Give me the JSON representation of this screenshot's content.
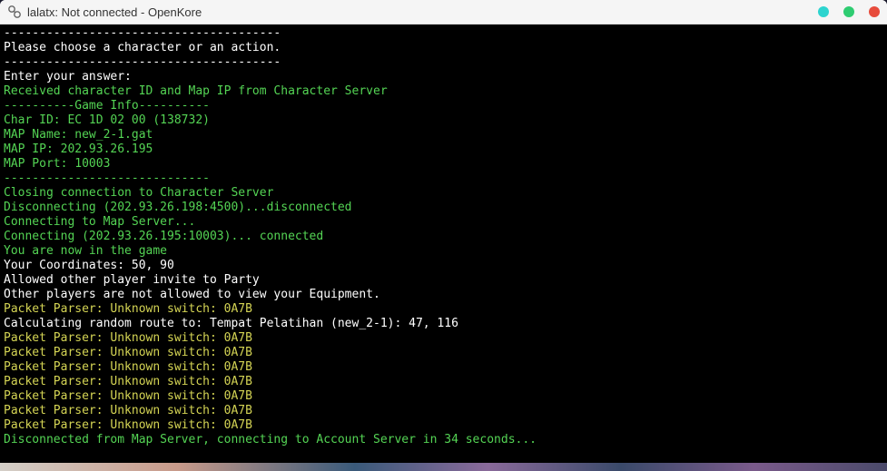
{
  "window": {
    "title": "lalatx: Not connected - OpenKore"
  },
  "lines": [
    {
      "cls": "w",
      "text": "---------------------------------------"
    },
    {
      "cls": "w",
      "text": "Please choose a character or an action."
    },
    {
      "cls": "w",
      "text": "---------------------------------------"
    },
    {
      "cls": "w",
      "text": "Enter your answer: "
    },
    {
      "cls": "g",
      "text": "Received character ID and Map IP from Character Server"
    },
    {
      "cls": "g",
      "text": "----------Game Info----------"
    },
    {
      "cls": "g",
      "text": "Char ID: EC 1D 02 00 (138732)"
    },
    {
      "cls": "g",
      "text": "MAP Name: new_2-1.gat"
    },
    {
      "cls": "g",
      "text": "MAP IP: 202.93.26.195"
    },
    {
      "cls": "g",
      "text": "MAP Port: 10003"
    },
    {
      "cls": "g",
      "text": "-----------------------------"
    },
    {
      "cls": "g",
      "text": "Closing connection to Character Server"
    },
    {
      "cls": "g",
      "text": "Disconnecting (202.93.26.198:4500)...disconnected"
    },
    {
      "cls": "g",
      "text": "Connecting to Map Server..."
    },
    {
      "cls": "g",
      "text": "Connecting (202.93.26.195:10003)... connected"
    },
    {
      "cls": "g",
      "text": "You are now in the game"
    },
    {
      "cls": "w",
      "text": "Your Coordinates: 50, 90"
    },
    {
      "cls": "w",
      "text": "Allowed other player invite to Party"
    },
    {
      "cls": "w",
      "text": "Other players are not allowed to view your Equipment."
    },
    {
      "cls": "y",
      "text": "Packet Parser: Unknown switch: 0A7B"
    },
    {
      "cls": "w",
      "text": "Calculating random route to: Tempat Pelatihan (new_2-1): 47, 116"
    },
    {
      "cls": "y",
      "text": "Packet Parser: Unknown switch: 0A7B"
    },
    {
      "cls": "y",
      "text": "Packet Parser: Unknown switch: 0A7B"
    },
    {
      "cls": "y",
      "text": "Packet Parser: Unknown switch: 0A7B"
    },
    {
      "cls": "y",
      "text": "Packet Parser: Unknown switch: 0A7B"
    },
    {
      "cls": "y",
      "text": "Packet Parser: Unknown switch: 0A7B"
    },
    {
      "cls": "y",
      "text": "Packet Parser: Unknown switch: 0A7B"
    },
    {
      "cls": "y",
      "text": "Packet Parser: Unknown switch: 0A7B"
    },
    {
      "cls": "g",
      "text": "Disconnected from Map Server, connecting to Account Server in 34 seconds..."
    }
  ]
}
